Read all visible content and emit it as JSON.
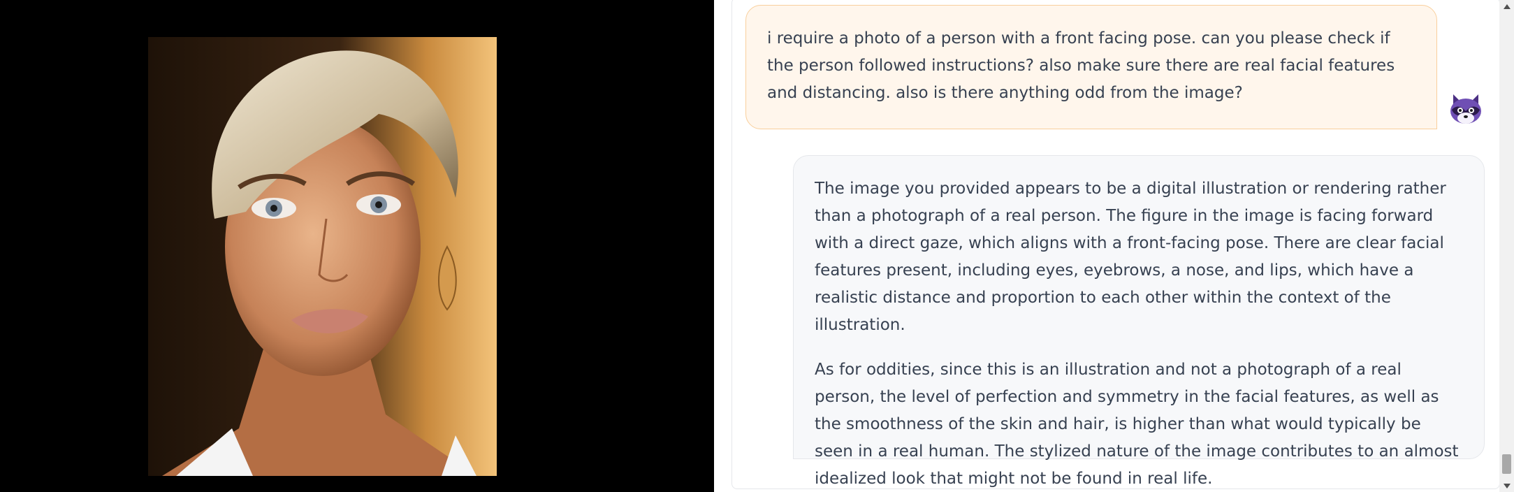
{
  "image_panel": {
    "image_icon": "portrait-image"
  },
  "chat": {
    "user_message": "i require a photo of a person with a front facing pose. can you please check if the person followed instructions? also make sure there are real facial features and distancing. also is there anything odd from the image?",
    "assistant_avatar_icon": "raccoon-avatar-icon",
    "assistant_paragraphs": [
      "The image you provided appears to be a digital illustration or rendering rather than a photograph of a real person. The figure in the image is facing forward with a direct gaze, which aligns with a front-facing pose. There are clear facial features present, including eyes, eyebrows, a nose, and lips, which have a realistic distance and proportion to each other within the context of the illustration.",
      "As for oddities, since this is an illustration and not a photograph of a real person, the level of perfection and symmetry in the facial features, as well as the smoothness of the skin and hair, is higher than what would typically be seen in a real human. The stylized nature of the image contributes to an almost idealized look that might not be found in real life."
    ]
  },
  "colors": {
    "user_bubble_bg": "#fff6ec",
    "user_bubble_border": "#f9cf9c",
    "assistant_bubble_bg": "#f7f8fa",
    "text": "#374151"
  }
}
